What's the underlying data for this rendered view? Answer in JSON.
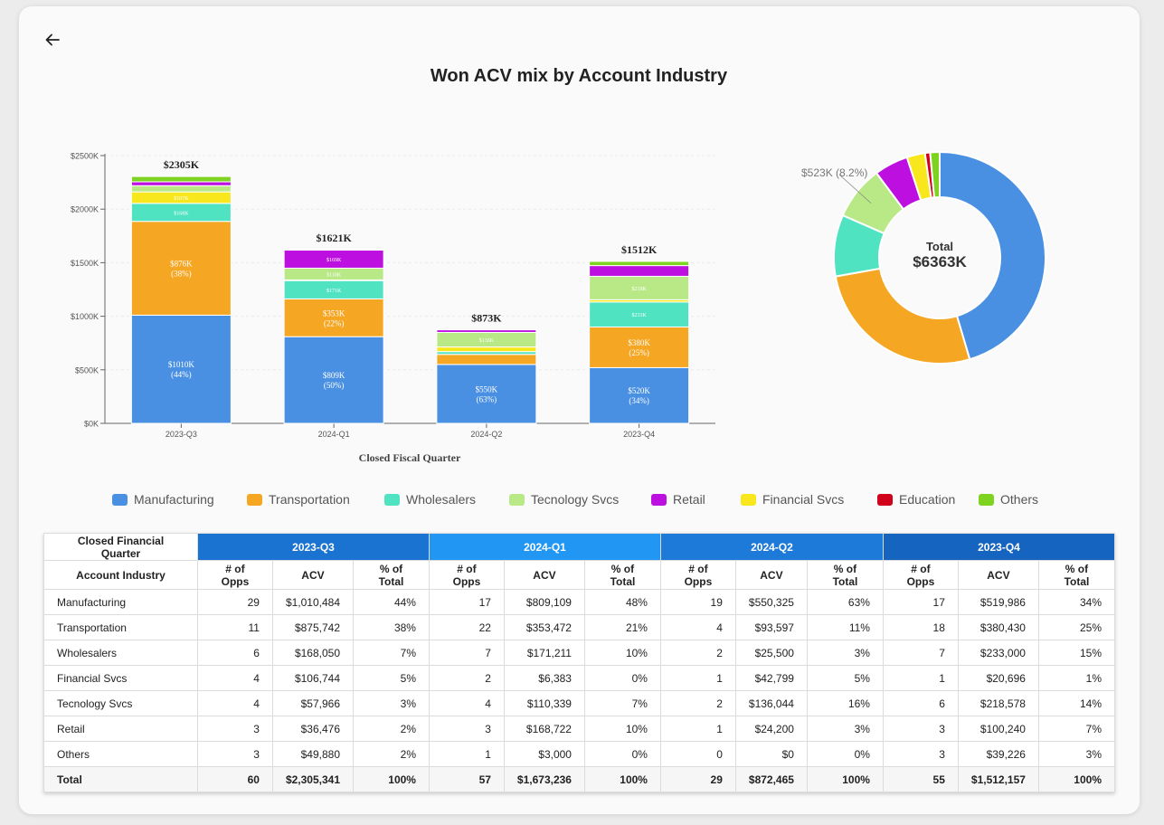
{
  "title": "Won ACV mix by Account Industry",
  "colors": {
    "Manufacturing": "#4a90e2",
    "Transportation": "#f5a623",
    "Wholesalers": "#50e3c2",
    "Tecnology Svcs": "#b8e986",
    "Retail": "#bd10e0",
    "Financial Svcs": "#f8e71c",
    "Education": "#d0021b",
    "Others": "#7ed321",
    "quarter_headers": [
      "#1a73d1",
      "#2196f3",
      "#1d7ad8",
      "#1565c0"
    ]
  },
  "legend": [
    "Manufacturing",
    "Transportation",
    "Wholesalers",
    "Tecnology Svcs",
    "Retail",
    "Financial Svcs",
    "Education",
    "Others"
  ],
  "chart_data": [
    {
      "type": "bar",
      "stacked": true,
      "xlabel": "Closed Fiscal Quarter",
      "ylabel": "",
      "ylim": [
        0,
        2500
      ],
      "yticks": [
        "$0K",
        "$500K",
        "$1000K",
        "$1500K",
        "$2000K",
        "$2500K"
      ],
      "categories": [
        "2023-Q3",
        "2024-Q1",
        "2024-Q2",
        "2023-Q4"
      ],
      "totals": [
        "$2305K",
        "$1621K",
        "$873K",
        "$1512K"
      ],
      "series": [
        {
          "name": "Manufacturing",
          "values": [
            1010,
            809,
            550,
            520
          ],
          "labels": [
            "$1010K",
            "$809K",
            "$550K",
            "$520K"
          ],
          "pct": [
            "(44%)",
            "(50%)",
            "(63%)",
            "(34%)"
          ]
        },
        {
          "name": "Transportation",
          "values": [
            876,
            353,
            94,
            380
          ],
          "labels": [
            "$876K",
            "$353K",
            "",
            "$380K"
          ],
          "pct": [
            "(38%)",
            "(22%)",
            "",
            "(25%)"
          ]
        },
        {
          "name": "Wholesalers",
          "values": [
            168,
            171,
            26,
            233
          ],
          "labels": [
            "$168K",
            "$171K",
            "",
            "$233K"
          ],
          "pct": [
            "",
            "",
            "",
            ""
          ]
        },
        {
          "name": "Financial Svcs",
          "values": [
            107,
            6,
            43,
            21
          ],
          "labels": [
            "$107K",
            "",
            "",
            ""
          ],
          "pct": [
            "",
            "",
            "",
            ""
          ]
        },
        {
          "name": "Tecnology Svcs",
          "values": [
            58,
            110,
            136,
            219
          ],
          "labels": [
            "",
            "$110K",
            "$136K",
            "$219K"
          ],
          "pct": [
            "",
            "",
            "",
            ""
          ]
        },
        {
          "name": "Retail",
          "values": [
            36,
            169,
            24,
            100
          ],
          "labels": [
            "",
            "$169K",
            "",
            ""
          ],
          "pct": [
            "",
            "",
            "",
            ""
          ]
        },
        {
          "name": "Others",
          "values": [
            50,
            3,
            0,
            39
          ],
          "labels": [
            "",
            "",
            "",
            ""
          ],
          "pct": [
            "",
            "",
            "",
            ""
          ]
        }
      ]
    },
    {
      "type": "pie",
      "donut": true,
      "center_label": "Total",
      "center_value": "$6363K",
      "callout": "$523K (8.2%)",
      "slices": [
        {
          "name": "Manufacturing",
          "value": 2890
        },
        {
          "name": "Transportation",
          "value": 1703
        },
        {
          "name": "Wholesalers",
          "value": 598
        },
        {
          "name": "Tecnology Svcs",
          "value": 523
        },
        {
          "name": "Retail",
          "value": 330
        },
        {
          "name": "Financial Svcs",
          "value": 177
        },
        {
          "name": "Education",
          "value": 50
        },
        {
          "name": "Others",
          "value": 92
        }
      ]
    }
  ],
  "table": {
    "corner": "Closed Financial Quarter",
    "row_header": "Account Industry",
    "quarters": [
      "2023-Q3",
      "2024-Q1",
      "2024-Q2",
      "2023-Q4"
    ],
    "subheaders": [
      "# of Opps",
      "ACV",
      "% of Total"
    ],
    "rows": [
      {
        "industry": "Manufacturing",
        "cells": [
          "29",
          "$1,010,484",
          "44%",
          "17",
          "$809,109",
          "48%",
          "19",
          "$550,325",
          "63%",
          "17",
          "$519,986",
          "34%"
        ]
      },
      {
        "industry": "Transportation",
        "cells": [
          "11",
          "$875,742",
          "38%",
          "22",
          "$353,472",
          "21%",
          "4",
          "$93,597",
          "11%",
          "18",
          "$380,430",
          "25%"
        ]
      },
      {
        "industry": "Wholesalers",
        "cells": [
          "6",
          "$168,050",
          "7%",
          "7",
          "$171,211",
          "10%",
          "2",
          "$25,500",
          "3%",
          "7",
          "$233,000",
          "15%"
        ]
      },
      {
        "industry": "Financial Svcs",
        "cells": [
          "4",
          "$106,744",
          "5%",
          "2",
          "$6,383",
          "0%",
          "1",
          "$42,799",
          "5%",
          "1",
          "$20,696",
          "1%"
        ]
      },
      {
        "industry": "Tecnology Svcs",
        "cells": [
          "4",
          "$57,966",
          "3%",
          "4",
          "$110,339",
          "7%",
          "2",
          "$136,044",
          "16%",
          "6",
          "$218,578",
          "14%"
        ]
      },
      {
        "industry": "Retail",
        "cells": [
          "3",
          "$36,476",
          "2%",
          "3",
          "$168,722",
          "10%",
          "1",
          "$24,200",
          "3%",
          "3",
          "$100,240",
          "7%"
        ]
      },
      {
        "industry": "Others",
        "cells": [
          "3",
          "$49,880",
          "2%",
          "1",
          "$3,000",
          "0%",
          "0",
          "$0",
          "0%",
          "3",
          "$39,226",
          "3%"
        ]
      }
    ],
    "total": {
      "industry": "Total",
      "cells": [
        "60",
        "$2,305,341",
        "100%",
        "57",
        "$1,673,236",
        "100%",
        "29",
        "$872,465",
        "100%",
        "55",
        "$1,512,157",
        "100%"
      ]
    }
  }
}
